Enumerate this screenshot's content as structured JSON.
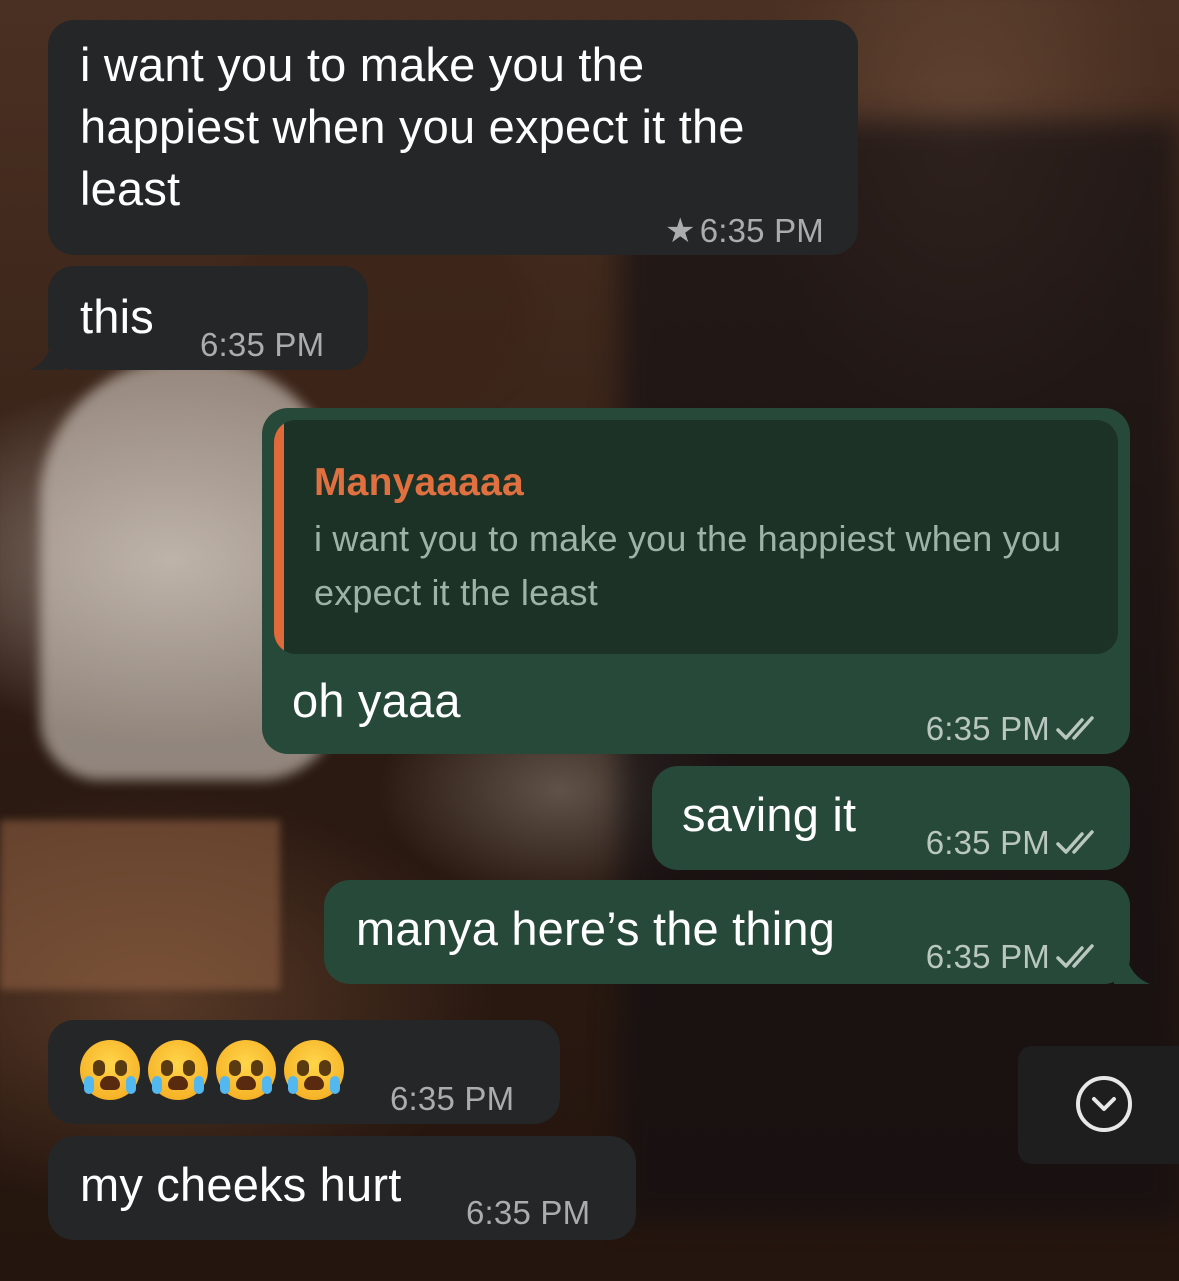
{
  "messages": [
    {
      "direction": "incoming",
      "text": "i want you to make you the happiest when you expect it the least",
      "time": "6:35 PM",
      "starred": true
    },
    {
      "direction": "incoming",
      "text": "this",
      "time": "6:35 PM"
    },
    {
      "direction": "outgoing",
      "reply_to": {
        "name": "Manyaaaaa",
        "text": "i want you to make you the happiest when you expect it the least"
      },
      "text": "oh yaaa",
      "time": "6:35 PM",
      "status": "read"
    },
    {
      "direction": "outgoing",
      "text": "saving it",
      "time": "6:35 PM",
      "status": "read"
    },
    {
      "direction": "outgoing",
      "text": "manya here’s the thing",
      "time": "6:35 PM",
      "status": "read"
    },
    {
      "direction": "incoming",
      "emoji": "😭😭😭😭",
      "time": "6:35 PM"
    },
    {
      "direction": "incoming",
      "text": "my cheeks hurt",
      "time": "6:35 PM"
    }
  ],
  "colors": {
    "incoming_bubble": "#242627",
    "outgoing_bubble": "#27493a",
    "quote_name": "#e0703f",
    "quote_bar": "#e06a3a"
  },
  "icons": {
    "star": "star-icon",
    "read_ticks": "double-check-icon",
    "scroll_down": "chevron-down-circle-icon"
  }
}
